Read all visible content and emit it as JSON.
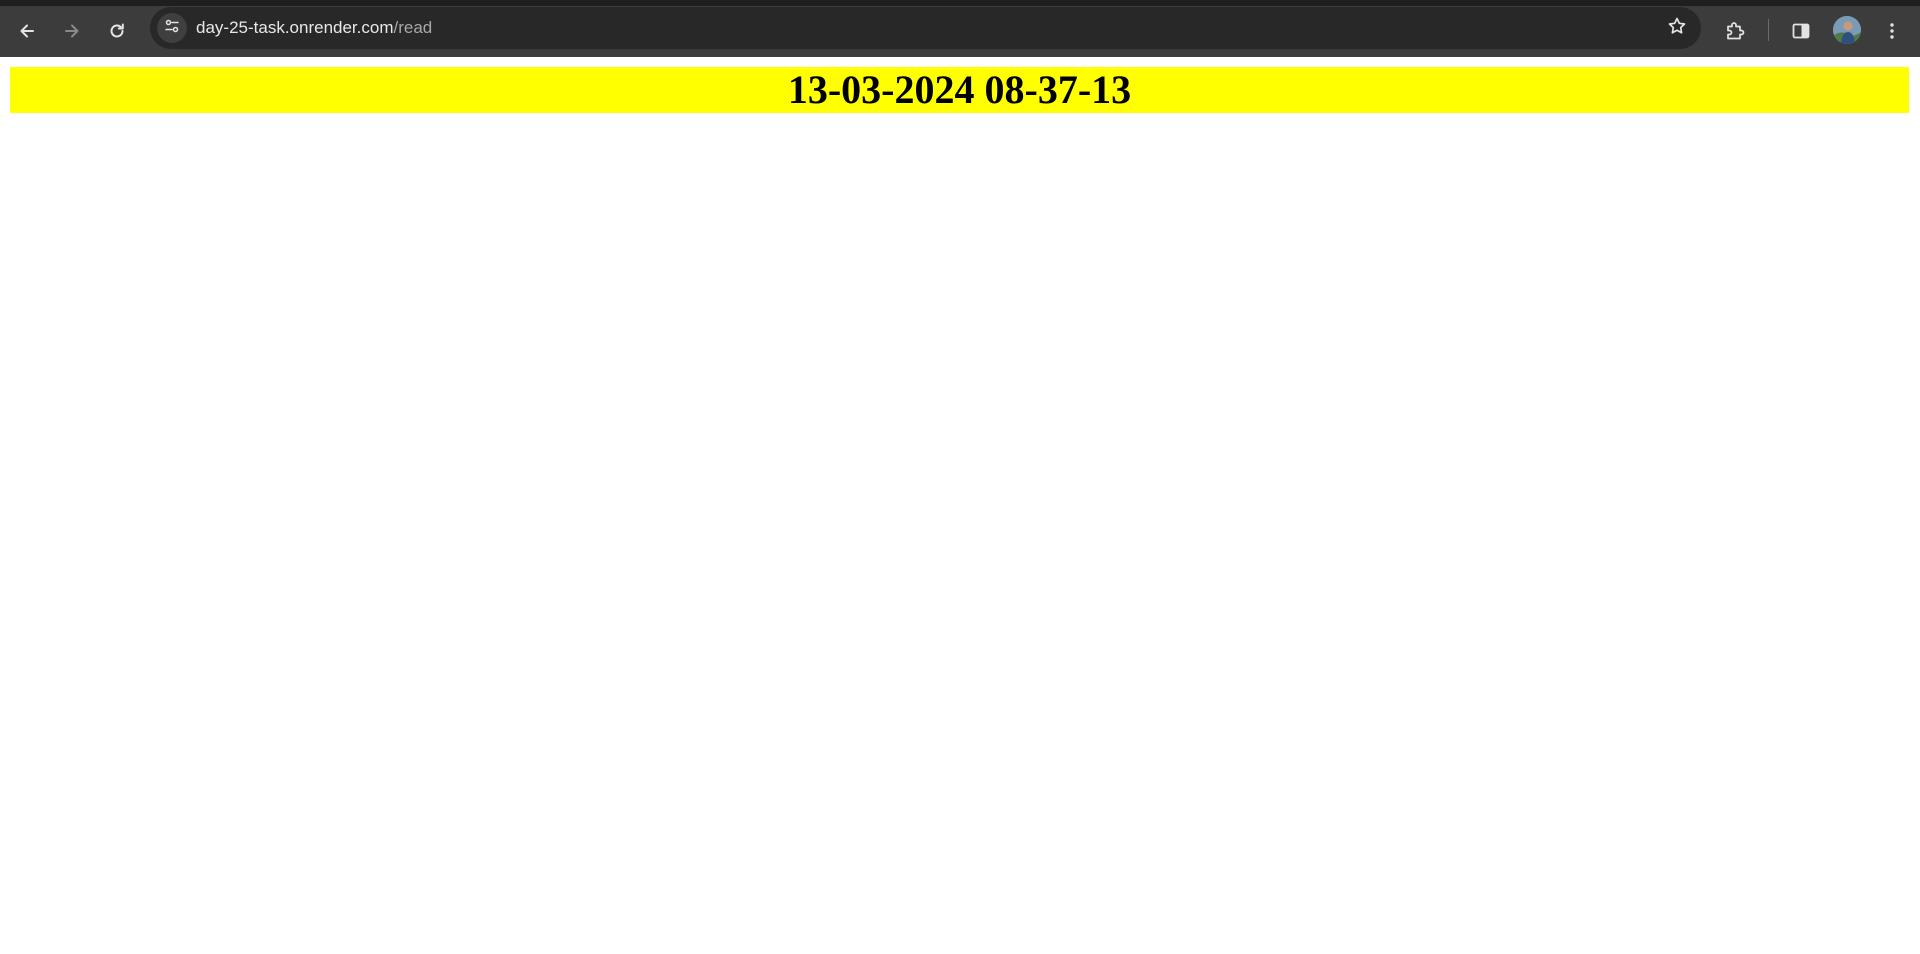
{
  "browser": {
    "url_host": "day-25-task.onrender.com",
    "url_path": "/read",
    "icons": {
      "back": "arrow-left-icon",
      "forward": "arrow-right-icon",
      "reload": "reload-icon",
      "site_info": "tune-icon",
      "bookmark": "star-outline-icon",
      "extensions": "puzzle-icon",
      "side_panel": "side-panel-icon",
      "menu": "kebab-menu-icon"
    },
    "colors": {
      "toolbar": "#3c3c3c",
      "omnibox": "#282828"
    }
  },
  "page": {
    "banner_text": "13-03-2024 08-37-13",
    "colors": {
      "banner_background": "#ffff00",
      "banner_text": "#000000",
      "page_background": "#ffffff"
    }
  }
}
